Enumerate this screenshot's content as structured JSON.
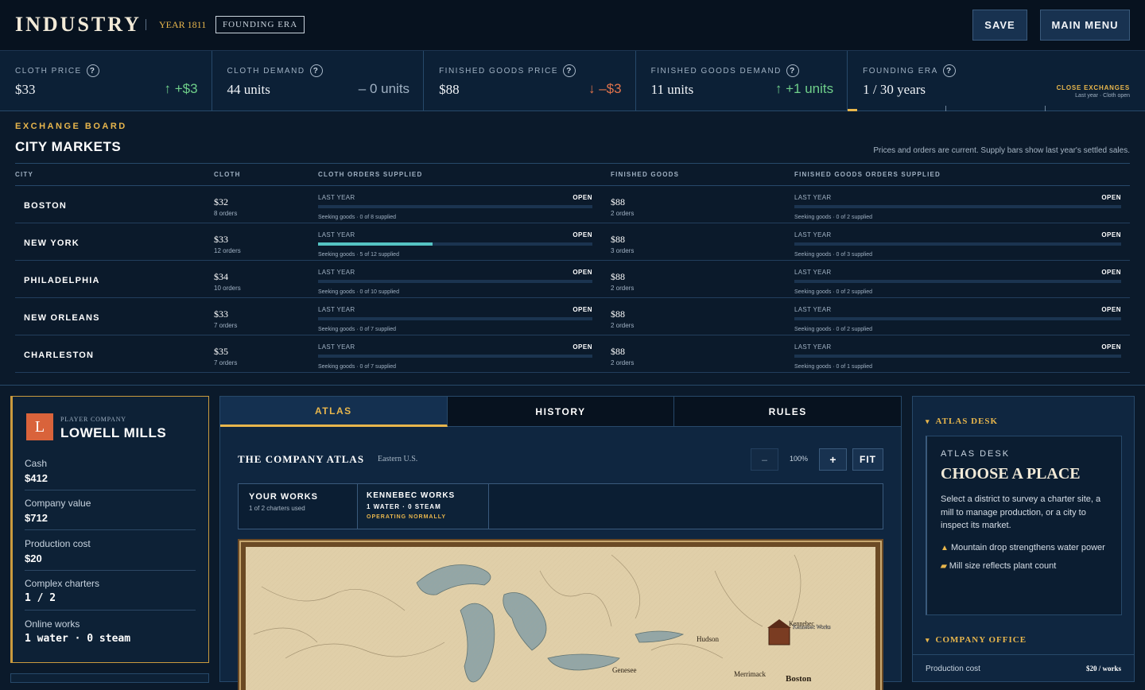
{
  "header": {
    "logo": "INDUSTRY",
    "year": "YEAR 1811",
    "era": "FOUNDING ERA",
    "save_label": "SAVE",
    "main_menu_label": "MAIN MENU"
  },
  "stats": [
    {
      "label": "CLOTH PRICE",
      "value": "$33",
      "delta": "↑ +$3",
      "trend": "up"
    },
    {
      "label": "CLOTH DEMAND",
      "value": "44 units",
      "delta": "– 0 units",
      "trend": "flat"
    },
    {
      "label": "FINISHED GOODS PRICE",
      "value": "$88",
      "delta": "↓ –$3",
      "trend": "down"
    },
    {
      "label": "FINISHED GOODS DEMAND",
      "value": "11 units",
      "delta": "↑ +1 units",
      "trend": "up"
    },
    {
      "label": "FOUNDING ERA",
      "value": "1 / 30 years",
      "close_label": "CLOSE EXCHANGES",
      "close_sub": "Last year · Cloth open",
      "progress": 0.033
    }
  ],
  "board": {
    "eyebrow": "EXCHANGE BOARD",
    "title": "CITY MARKETS",
    "note": "Prices and orders are current. Supply bars show last year's settled sales.",
    "columns": [
      "CITY",
      "CLOTH",
      "CLOTH ORDERS SUPPLIED",
      "FINISHED GOODS",
      "FINISHED GOODS ORDERS SUPPLIED"
    ],
    "last_year_label": "LAST YEAR",
    "open_label": "OPEN",
    "rows": [
      {
        "city": "BOSTON",
        "cloth_price": "$32",
        "cloth_orders": "8 orders",
        "cloth_supplied": "Seeking goods · 0 of 8 supplied",
        "cloth_fill": 0,
        "fg_price": "$88",
        "fg_orders": "2 orders",
        "fg_supplied": "Seeking goods · 0 of 2 supplied",
        "fg_fill": 0
      },
      {
        "city": "NEW YORK",
        "cloth_price": "$33",
        "cloth_orders": "12 orders",
        "cloth_supplied": "Seeking goods · 5 of 12 supplied",
        "cloth_fill": 0.4167,
        "fg_price": "$88",
        "fg_orders": "3 orders",
        "fg_supplied": "Seeking goods · 0 of 3 supplied",
        "fg_fill": 0
      },
      {
        "city": "PHILADELPHIA",
        "cloth_price": "$34",
        "cloth_orders": "10 orders",
        "cloth_supplied": "Seeking goods · 0 of 10 supplied",
        "cloth_fill": 0,
        "fg_price": "$88",
        "fg_orders": "2 orders",
        "fg_supplied": "Seeking goods · 0 of 2 supplied",
        "fg_fill": 0
      },
      {
        "city": "NEW ORLEANS",
        "cloth_price": "$33",
        "cloth_orders": "7 orders",
        "cloth_supplied": "Seeking goods · 0 of 7 supplied",
        "cloth_fill": 0,
        "fg_price": "$88",
        "fg_orders": "2 orders",
        "fg_supplied": "Seeking goods · 0 of 2 supplied",
        "fg_fill": 0
      },
      {
        "city": "CHARLESTON",
        "cloth_price": "$35",
        "cloth_orders": "7 orders",
        "cloth_supplied": "Seeking goods · 0 of 7 supplied",
        "cloth_fill": 0,
        "fg_price": "$88",
        "fg_orders": "2 orders",
        "fg_supplied": "Seeking goods · 0 of 1 supplied",
        "fg_fill": 0
      }
    ]
  },
  "company": {
    "badge": "L",
    "kicker": "PLAYER COMPANY",
    "name": "LOWELL MILLS",
    "rows": [
      {
        "label": "Cash",
        "value": "$412"
      },
      {
        "label": "Company value",
        "value": "$712"
      },
      {
        "label": "Production cost",
        "value": "$20"
      },
      {
        "label": "Complex charters",
        "value": "1 / 2"
      },
      {
        "label": "Online works",
        "value": "1 water · 0 steam"
      }
    ]
  },
  "atlas": {
    "tabs": [
      "ATLAS",
      "HISTORY",
      "RULES"
    ],
    "title": "THE COMPANY ATLAS",
    "region": "Eastern U.S.",
    "zoom_out": "–",
    "zoom": "100%",
    "zoom_in": "+",
    "fit": "FIT",
    "works_title": "YOUR WORKS",
    "works_sub": "1 of 2 charters used",
    "mill_name": "KENNEBEC WORKS",
    "mill_power": "1 WATER · 0 STEAM",
    "mill_status": "OPERATING NORMALLY",
    "map_labels": [
      "Hudson",
      "Genesee",
      "Merrimack",
      "Boston",
      "Kennebec",
      "Kennebec Works"
    ]
  },
  "desk": {
    "section1": "ATLAS DESK",
    "kicker": "ATLAS DESK",
    "heading": "CHOOSE A PLACE",
    "body": "Select a district to survey a charter site, a mill to manage production, or a city to inspect its market.",
    "bullet1": "Mountain drop strengthens water power",
    "bullet2": "Mill size reflects plant count",
    "section2": "COMPANY OFFICE",
    "prod_label": "Production cost",
    "prod_value": "$20 / works"
  },
  "colors": {
    "accent": "#e8b64c",
    "panel": "#0f2640",
    "bg": "#0b1a2b",
    "supply_bar": "#55c3c3",
    "badge": "#d9633b"
  }
}
